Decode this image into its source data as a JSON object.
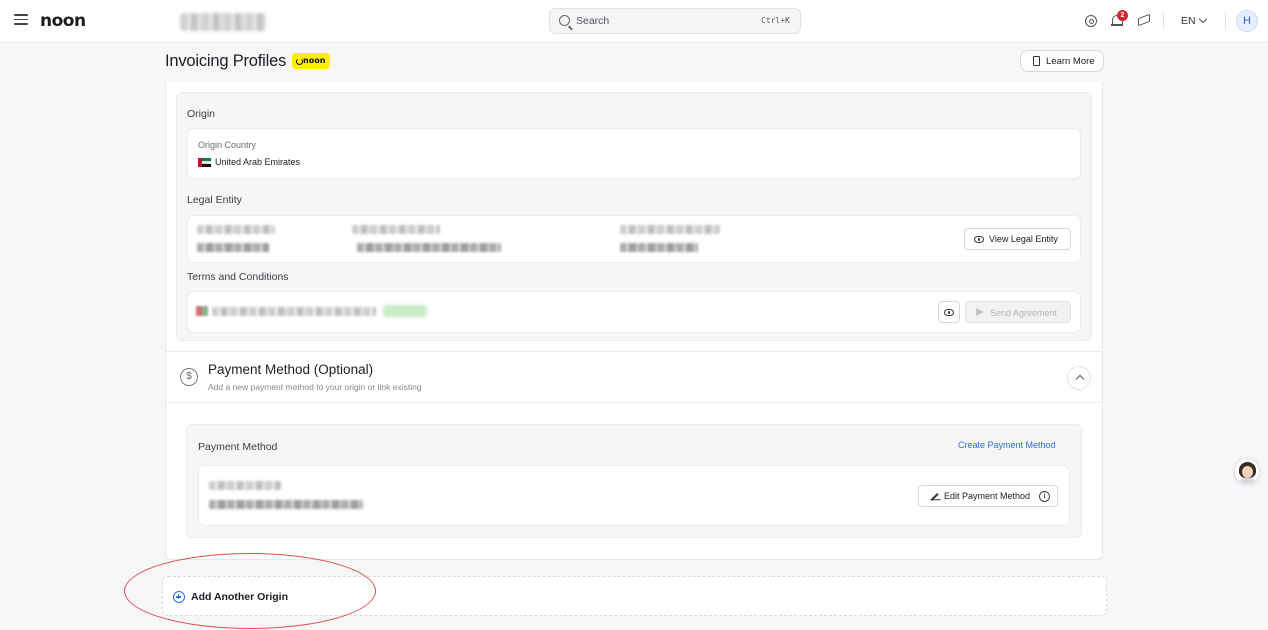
{
  "topbar": {
    "logo": "noon",
    "search_label": "Search",
    "search_shortcut": "Ctrl+K",
    "notification_count": "2",
    "language": "EN",
    "avatar_initial": "H"
  },
  "header": {
    "title": "Invoicing Profiles",
    "brand_chip": "noon",
    "learn_more": "Learn More"
  },
  "origin": {
    "section_title": "Origin",
    "country_label": "Origin Country",
    "country_value": "United Arab Emirates",
    "legal_entity_title": "Legal Entity",
    "view_legal_entity": "View Legal Entity",
    "terms_title": "Terms and Conditions",
    "send_agreement": "Send Agreement"
  },
  "payment": {
    "title": "Payment Method (Optional)",
    "subtitle": "Add a new payment method to your origin or link existing",
    "panel_label": "Payment Method",
    "create_link": "Create Payment Method",
    "edit_button": "Edit Payment Method"
  },
  "add_origin": {
    "label": "Add Another Origin"
  },
  "colors": {
    "accent_blue": "#2d6fd6",
    "brand_yellow": "#feee00",
    "annotation_red": "#e0504a",
    "badge_red": "#d8262c"
  }
}
